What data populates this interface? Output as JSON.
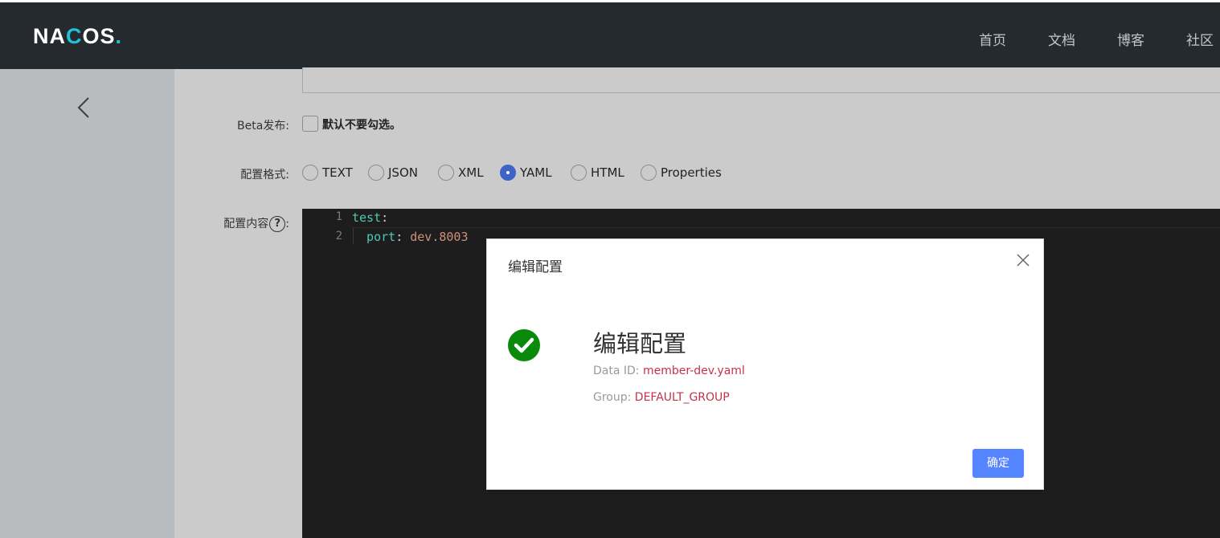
{
  "header": {
    "logo_text_1": "NA",
    "logo_text_2": "C",
    "logo_text_3": "OS",
    "logo_text_4": ".",
    "nav": [
      {
        "label": "首页"
      },
      {
        "label": "文档"
      },
      {
        "label": "博客"
      },
      {
        "label": "社区"
      }
    ]
  },
  "sidebar": {
    "back_icon": "chevron-left-icon"
  },
  "form": {
    "beta_label": "Beta发布:",
    "beta_checkbox_text": "默认不要勾选。",
    "beta_checked": false,
    "format_label": "配置格式:",
    "format_options": [
      {
        "label": "TEXT",
        "selected": false
      },
      {
        "label": "JSON",
        "selected": false
      },
      {
        "label": "XML",
        "selected": false
      },
      {
        "label": "YAML",
        "selected": true
      },
      {
        "label": "HTML",
        "selected": false
      },
      {
        "label": "Properties",
        "selected": false
      }
    ],
    "content_label": "配置内容",
    "content_label_colon": ":",
    "help_symbol": "?"
  },
  "editor": {
    "lines": [
      {
        "num": "1",
        "key": "test",
        "punc": ":",
        "value": ""
      },
      {
        "num": "2",
        "key": "  port",
        "punc": ": ",
        "value": "dev.8003"
      }
    ]
  },
  "dialog": {
    "title": "编辑配置",
    "message_title": "编辑配置",
    "data_id_label": "Data ID:",
    "data_id_value": "member-dev.yaml",
    "group_label": "Group:",
    "group_value": "DEFAULT_GROUP",
    "ok_label": "确定",
    "icon": "success-check-icon"
  },
  "colors": {
    "topbar": "#252a2f",
    "accent": "#5584ff",
    "success": "#0a8a0a",
    "value_red": "#c4314b"
  }
}
